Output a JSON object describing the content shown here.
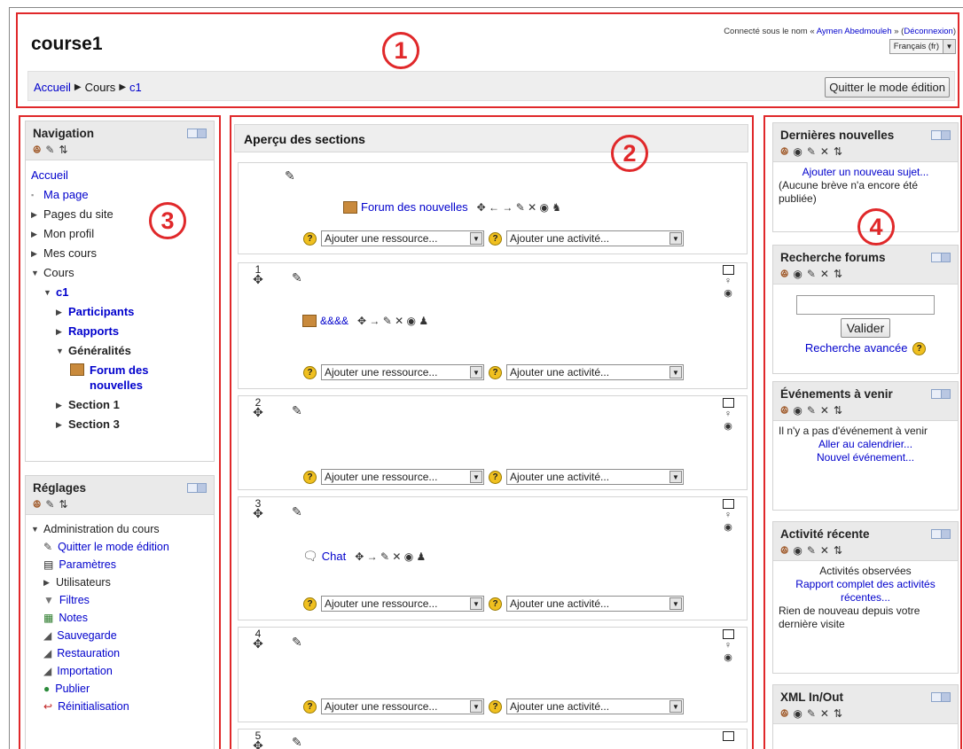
{
  "header": {
    "course_title": "course1",
    "login_prefix": "Connecté sous le nom « ",
    "login_user": "Aymen Abedmouleh",
    "login_mid": " » (",
    "logout": "Déconnexion",
    "login_suffix": ")",
    "language": "Français (fr)",
    "breadcrumb": [
      "Accueil",
      "Cours",
      "c1"
    ],
    "quit_edit_button": "Quitter le mode édition"
  },
  "annotations": [
    "1",
    "2",
    "3",
    "4"
  ],
  "navigation": {
    "title": "Navigation",
    "items": [
      {
        "label": "Accueil"
      },
      {
        "label": "Ma page"
      },
      {
        "label": "Pages du site"
      },
      {
        "label": "Mon profil"
      },
      {
        "label": "Mes cours"
      },
      {
        "label": "Cours"
      },
      {
        "label": "c1"
      },
      {
        "label": "Participants"
      },
      {
        "label": "Rapports"
      },
      {
        "label": "Généralités"
      },
      {
        "label": "Forum des nouvelles"
      },
      {
        "label": "Section 1"
      },
      {
        "label": "Section 3"
      }
    ]
  },
  "settings": {
    "title": "Réglages",
    "items": [
      {
        "label": "Administration du cours"
      },
      {
        "label": "Quitter le mode édition"
      },
      {
        "label": "Paramètres"
      },
      {
        "label": "Utilisateurs"
      },
      {
        "label": "Filtres"
      },
      {
        "label": "Notes"
      },
      {
        "label": "Sauvegarde"
      },
      {
        "label": "Restauration"
      },
      {
        "label": "Importation"
      },
      {
        "label": "Publier"
      },
      {
        "label": "Réinitialisation"
      }
    ]
  },
  "center": {
    "title": "Aperçu des sections",
    "add_resource": "Ajouter une ressource...",
    "add_activity": "Ajouter une activité...",
    "sections": [
      {
        "number": "",
        "activity": "Forum des nouvelles"
      },
      {
        "number": "1",
        "activity": "&&&&"
      },
      {
        "number": "2",
        "activity": ""
      },
      {
        "number": "3",
        "activity": "Chat"
      },
      {
        "number": "4",
        "activity": ""
      },
      {
        "number": "5",
        "activity": ""
      }
    ]
  },
  "right": {
    "news": {
      "title": "Dernières nouvelles",
      "add_link": "Ajouter un nouveau sujet...",
      "empty": "(Aucune brève n'a encore été publiée)"
    },
    "search": {
      "title": "Recherche forums",
      "button": "Valider",
      "advanced": "Recherche avancée"
    },
    "events": {
      "title": "Événements à venir",
      "empty": "Il n'y a pas d'événement à venir",
      "calendar": "Aller au calendrier...",
      "new_event": "Nouvel événement..."
    },
    "recent": {
      "title": "Activité récente",
      "observed": "Activités observées",
      "report": "Rapport complet des activités récentes...",
      "nothing": "Rien de nouveau depuis votre dernière visite"
    },
    "xml": {
      "title": "XML In/Out"
    }
  },
  "colors": {
    "annotation": "#e0282a",
    "link": "#0000cc",
    "block_header": "#eaeaea"
  }
}
